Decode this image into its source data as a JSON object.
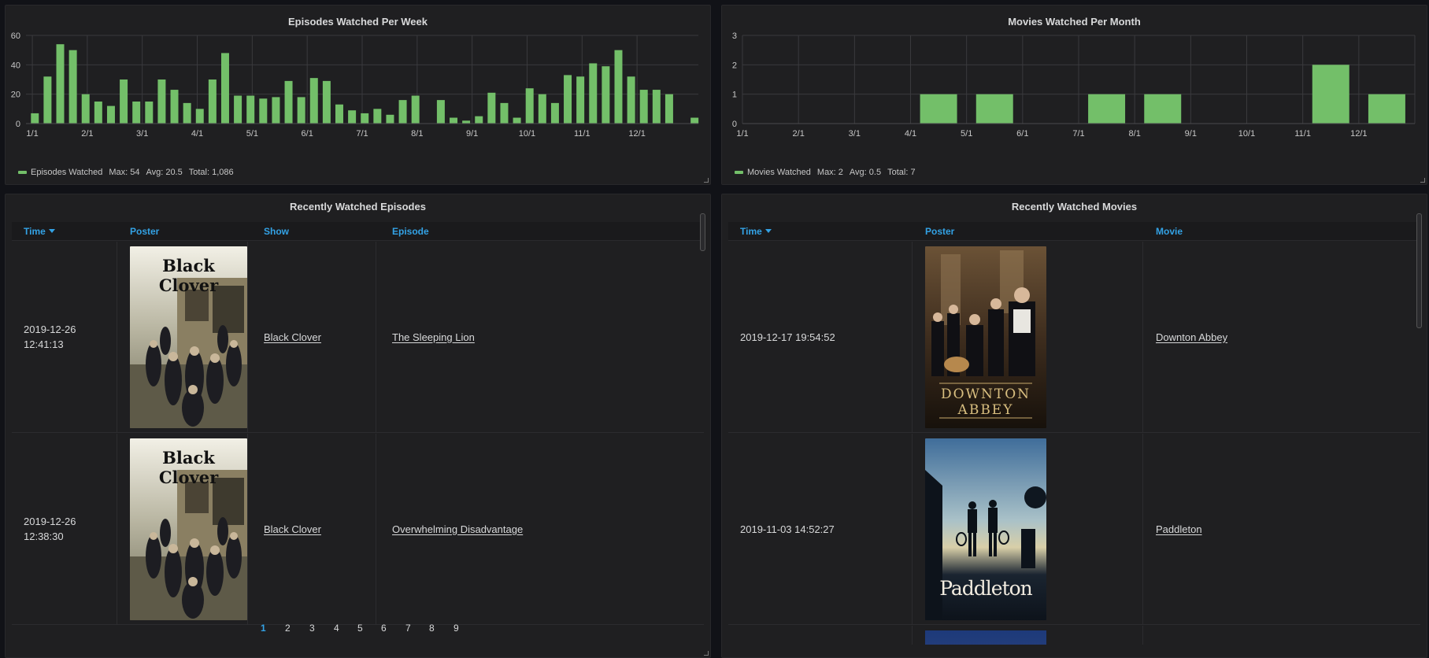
{
  "episodes_chart_panel": {
    "title": "Episodes Watched Per Week",
    "legend": {
      "name": "Episodes Watched",
      "max": "Max: 54",
      "avg": "Avg: 20.5",
      "total": "Total: 1,086"
    }
  },
  "movies_chart_panel": {
    "title": "Movies Watched Per Month",
    "legend": {
      "name": "Movies Watched",
      "max": "Max: 2",
      "avg": "Avg: 0.5",
      "total": "Total: 7"
    }
  },
  "colors": {
    "bar": "#73bf69",
    "link_header": "#33a2e5",
    "panel_bg": "#1f1f21",
    "page_bg": "#111217"
  },
  "chart_data": [
    {
      "type": "bar",
      "title": "Episodes Watched Per Week",
      "xlabel": "",
      "ylabel": "",
      "ylim": [
        0,
        60
      ],
      "yticks": [
        0,
        20,
        40,
        60
      ],
      "xtick_labels": [
        "1/1",
        "2/1",
        "3/1",
        "4/1",
        "5/1",
        "6/1",
        "7/1",
        "8/1",
        "9/1",
        "10/1",
        "11/1",
        "12/1"
      ],
      "grid": true,
      "legend_position": "bottom-left",
      "series": [
        {
          "name": "Episodes Watched",
          "values": [
            7,
            32,
            54,
            50,
            20,
            15,
            12,
            30,
            15,
            15,
            30,
            23,
            14,
            10,
            30,
            48,
            19,
            19,
            17,
            18,
            29,
            18,
            31,
            29,
            13,
            9,
            7,
            10,
            6,
            16,
            19,
            0,
            16,
            4,
            2,
            5,
            21,
            14,
            4,
            24,
            20,
            14,
            33,
            32,
            41,
            39,
            50,
            32,
            23,
            23,
            20,
            0,
            4
          ]
        }
      ]
    },
    {
      "type": "bar",
      "title": "Movies Watched Per Month",
      "xlabel": "",
      "ylabel": "",
      "ylim": [
        0,
        3
      ],
      "yticks": [
        0,
        1,
        2,
        3
      ],
      "categories": [
        "1/1",
        "2/1",
        "3/1",
        "4/1",
        "5/1",
        "6/1",
        "7/1",
        "8/1",
        "9/1",
        "10/1",
        "11/1",
        "12/1"
      ],
      "grid": true,
      "legend_position": "bottom-left",
      "series": [
        {
          "name": "Movies Watched",
          "values": [
            0,
            0,
            0,
            1,
            1,
            0,
            1,
            1,
            0,
            0,
            2,
            1
          ]
        }
      ]
    }
  ],
  "episodes_table": {
    "title": "Recently Watched Episodes",
    "columns": [
      "Time",
      "Poster",
      "Show",
      "Episode"
    ],
    "rows": [
      {
        "time_date": "2019-12-26",
        "time_clock": "12:41:13",
        "poster": "Black Clover",
        "show": "Black Clover",
        "episode": "The Sleeping Lion"
      },
      {
        "time_date": "2019-12-26",
        "time_clock": "12:38:30",
        "poster": "Black Clover",
        "show": "Black Clover",
        "episode": "Overwhelming Disadvantage"
      }
    ],
    "pages": [
      "1",
      "2",
      "3",
      "4",
      "5",
      "6",
      "7",
      "8",
      "9"
    ],
    "current_page": "1"
  },
  "movies_table": {
    "title": "Recently Watched Movies",
    "columns": [
      "Time",
      "Poster",
      "Movie"
    ],
    "rows": [
      {
        "time": "2019-12-17 19:54:52",
        "poster_line1": "DOWNTON",
        "poster_line2": "ABBEY",
        "movie": "Downton Abbey"
      },
      {
        "time": "2019-11-03 14:52:27",
        "poster_line1": "Paddleton",
        "movie": "Paddleton"
      }
    ]
  }
}
